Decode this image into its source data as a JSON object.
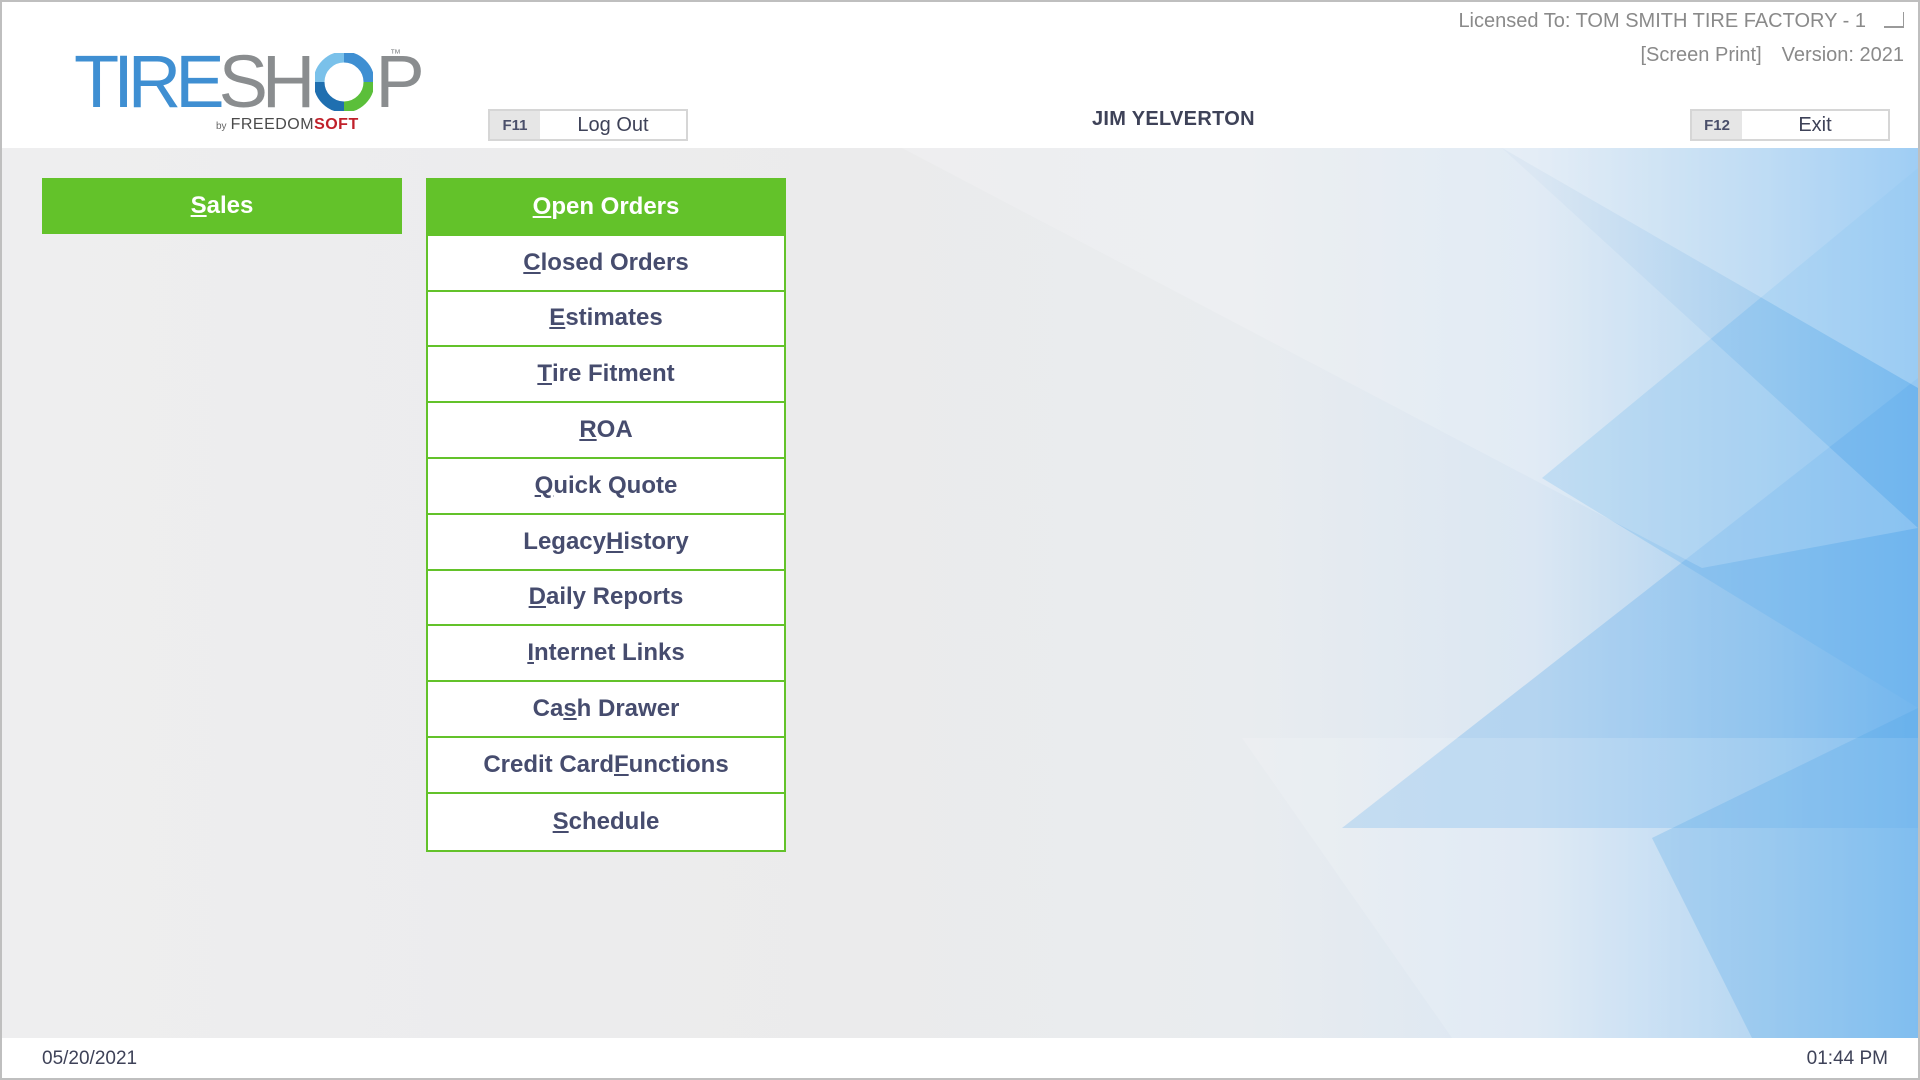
{
  "header": {
    "logo": {
      "brand_part1": "TIRE",
      "brand_part2": "SH",
      "brand_part3": "P",
      "tm": "™",
      "by": "by",
      "sub_part1": "FREEDOM",
      "sub_part2": "SOFT"
    },
    "license": "Licensed To: TOM SMITH TIRE FACTORY - 1",
    "screen_print": "[Screen Print]",
    "version": "Version: 2021",
    "logout": {
      "key": "F11",
      "label": "Log Out"
    },
    "exit": {
      "key": "F12",
      "label": "Exit"
    },
    "user": "JIM YELVERTON"
  },
  "sidebar": {
    "sales": {
      "hotkey": "S",
      "rest": "ales"
    }
  },
  "menu": {
    "items": [
      {
        "pre": "",
        "hotkey": "O",
        "post": "pen Orders",
        "active": true
      },
      {
        "pre": "",
        "hotkey": "C",
        "post": "losed Orders"
      },
      {
        "pre": "",
        "hotkey": "E",
        "post": "stimates"
      },
      {
        "pre": "",
        "hotkey": "T",
        "post": "ire Fitment"
      },
      {
        "pre": "",
        "hotkey": "R",
        "post": "OA"
      },
      {
        "pre": "",
        "hotkey": "Q",
        "post": "uick Quote"
      },
      {
        "pre": "Legacy ",
        "hotkey": "H",
        "post": "istory"
      },
      {
        "pre": "",
        "hotkey": "D",
        "post": "aily Reports"
      },
      {
        "pre": "",
        "hotkey": "I",
        "post": "nternet Links"
      },
      {
        "pre": "Ca",
        "hotkey": "s",
        "post": "h Drawer"
      },
      {
        "pre": "Credit Card ",
        "hotkey": "F",
        "post": "unctions"
      },
      {
        "pre": "",
        "hotkey": "S",
        "post": "chedule"
      }
    ]
  },
  "footer": {
    "date": "05/20/2021",
    "time": "01:44 PM"
  },
  "colors": {
    "accent_green": "#63c22a",
    "logo_blue": "#3f8fd2",
    "logo_grey": "#8a8d8f",
    "freedomsoft_red": "#c0202a",
    "text_navy": "#464c6e"
  },
  "icons": {
    "minimize": "minimize-icon"
  }
}
